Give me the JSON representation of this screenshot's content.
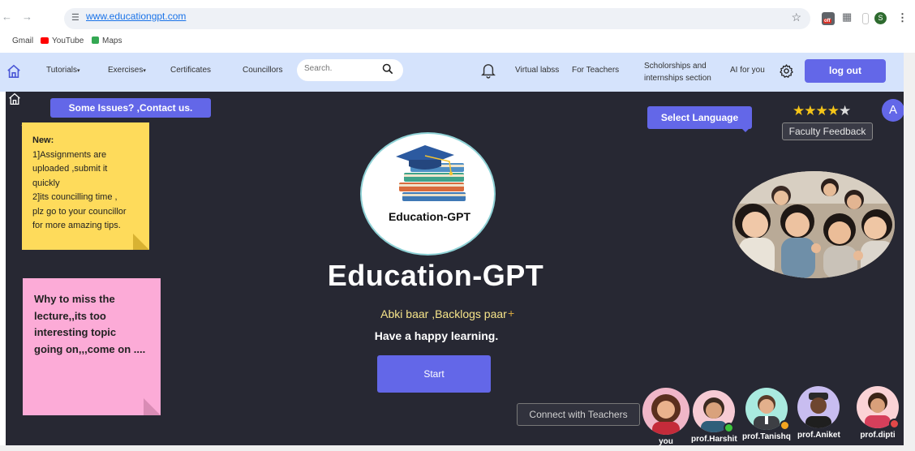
{
  "browser": {
    "url": "www.educationgpt.com",
    "bookmarks": [
      "Gmail",
      "YouTube",
      "Maps"
    ],
    "extension_badge": "off",
    "profile_initial": "S"
  },
  "nav": {
    "items": [
      "Tutorials",
      "Exercises",
      "Certificates",
      "Councillors"
    ],
    "search_placeholder": "Search.",
    "right_items": [
      "Virtual labss",
      "For Teachers"
    ],
    "scholarships": [
      "Scholorships and",
      "internships section"
    ],
    "ai_item": "AI for you",
    "logout": "log out"
  },
  "main": {
    "issues_button": "Some Issues? ,Contact us.",
    "notice": {
      "title": "New:",
      "lines": [
        "1]Assignments are",
        "uploaded ,submit it",
        "quickly",
        "2]its councilling time ,",
        "plz go to your councillor",
        "for more amazing tips."
      ]
    },
    "reminder": [
      "Why to miss the",
      "lecture,,its too",
      "interesting topic",
      "going on,,,come on ...."
    ],
    "logo_text": "Education-GPT",
    "headline": "Education-GPT",
    "tagline": "Abki baar ,Backlogs paar",
    "tagline_mark": "+",
    "subtitle": "Have a happy learning.",
    "start_button": "Start",
    "language_button": "Select Language",
    "rating": 4,
    "rating_max": 5,
    "feedback_button": "Faculty Feedback",
    "user_avatar": "A",
    "connect_button": "Connect  with Teachers",
    "people": [
      {
        "name": "you",
        "status": "none"
      },
      {
        "name": "prof.Harshit",
        "status": "online"
      },
      {
        "name": "prof.Tanishq",
        "status": "away"
      },
      {
        "name": "prof.Aniket",
        "status": "none"
      },
      {
        "name": "prof.dipti",
        "status": "busy"
      }
    ]
  },
  "colors": {
    "accent": "#6367e8",
    "background": "#272833",
    "navbar": "#d5e3fc",
    "note_yellow": "#fedb5b",
    "note_pink": "#fcabd7",
    "online": "#3cc43c",
    "away": "#f2a51f",
    "busy": "#e24848"
  }
}
